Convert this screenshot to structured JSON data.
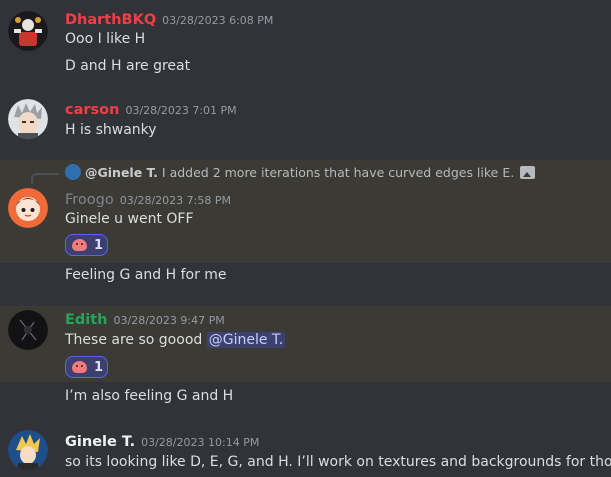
{
  "colors": {
    "dharth": "#f23f43",
    "carson": "#f23f43",
    "froogo": "#80848e",
    "edith": "#23a55a",
    "ginele": "#f2f3f5",
    "highlight_bg": "#3b3a34",
    "mention_bg": "#3c4270"
  },
  "messages": [
    {
      "username": "DharthBKQ",
      "timestamp": "03/28/2023 6:08 PM",
      "lines": [
        "Ooo I like H",
        "D and H are great"
      ]
    },
    {
      "username": "carson",
      "timestamp": "03/28/2023 7:01 PM",
      "lines": [
        "H is shwanky"
      ]
    },
    {
      "reply": {
        "name": "@Ginele T.",
        "text": "I added 2 more iterations that have curved edges like E."
      },
      "username": "Froogo",
      "timestamp": "03/28/2023 7:58 PM",
      "lines": [
        "Ginele u went OFF",
        "Feeling G and H for me"
      ],
      "reaction": {
        "icon": "pink-blob-emoji",
        "count": "1"
      }
    },
    {
      "username": "Edith",
      "timestamp": "03/28/2023 9:47 PM",
      "lines": [
        "These are so goood",
        "I’m also feeling G and H"
      ],
      "mention": "@Ginele T.",
      "reaction": {
        "icon": "pink-blob-emoji",
        "count": "1"
      }
    },
    {
      "username": "Ginele T.",
      "timestamp": "03/28/2023 10:14 PM",
      "lines": [
        "so its looking like D, E, G, and H. I’ll work on textures and backgrounds for those"
      ]
    }
  ]
}
